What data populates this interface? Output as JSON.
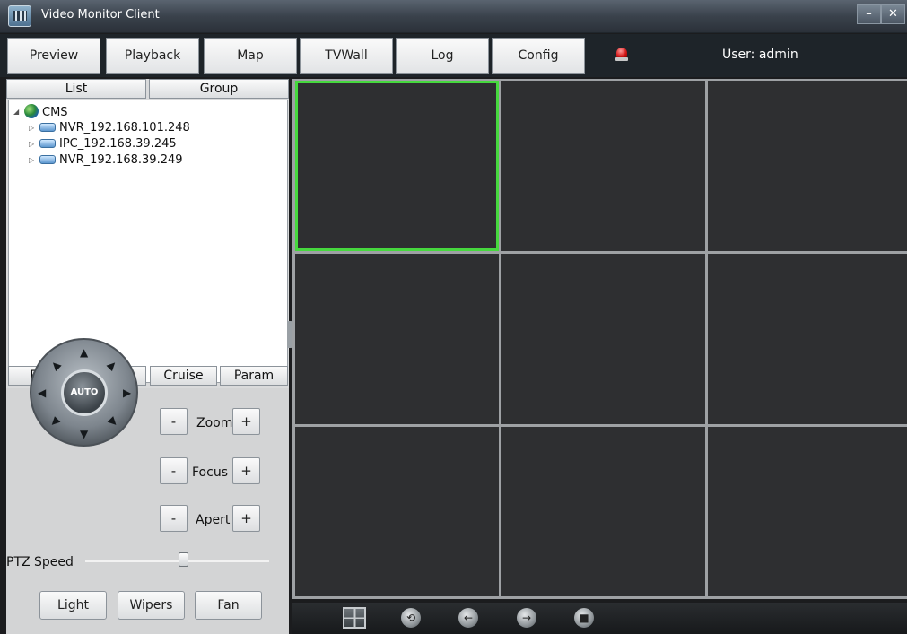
{
  "window": {
    "title": "Video Monitor Client",
    "minimize_glyph": "–",
    "close_glyph": "✕"
  },
  "tabs": [
    {
      "label": "Preview"
    },
    {
      "label": "Playback"
    },
    {
      "label": "Map"
    },
    {
      "label": "TVWall"
    },
    {
      "label": "Log"
    },
    {
      "label": "Config"
    }
  ],
  "user_label": "User: admin",
  "alarm_icon": "alarm-light-icon",
  "device_panel": {
    "tabs": [
      "List",
      "Group"
    ],
    "tree": {
      "root": "CMS",
      "devices": [
        "NVR_192.168.101.248",
        "IPC_192.168.39.245",
        "NVR_192.168.39.249"
      ]
    }
  },
  "ptz_panel": {
    "tabs": [
      "PTZ",
      "Preset",
      "Cruise",
      "Param"
    ],
    "joystick_center_label": "AUTO",
    "controls": [
      {
        "minus": "-",
        "label": "Zoom",
        "plus": "+"
      },
      {
        "minus": "-",
        "label": "Focus",
        "plus": "+"
      },
      {
        "minus": "-",
        "label": "Apert",
        "plus": "+"
      }
    ],
    "speed_label": "PTZ Speed",
    "speed_level": 0.5,
    "buttons": [
      "Light",
      "Wipers",
      "Fan"
    ]
  },
  "video_grid": {
    "rows": 3,
    "cols": 3,
    "selected_cell": 0
  },
  "bottom_toolbar": {
    "icons": [
      "layout-grid-icon",
      "record-icon",
      "previous-icon",
      "next-icon",
      "stop-icon"
    ],
    "glyphs": [
      "⟲",
      "←",
      "→",
      "■"
    ]
  }
}
